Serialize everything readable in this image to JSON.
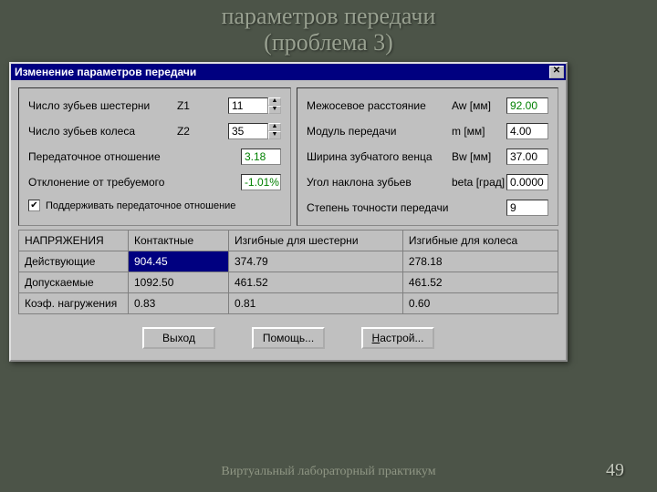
{
  "slide": {
    "title_line1": "параметров передачи",
    "title_line2": "(проблема 3)",
    "footer": "Виртуальный лабораторный практикум",
    "page": "49"
  },
  "dialog": {
    "title": "Изменение параметров передачи",
    "close": "✕"
  },
  "left": {
    "z1_label": "Число зубьев шестерни",
    "z1_sym": "Z1",
    "z1_val": "11",
    "z2_label": "Число зубьев колеса",
    "z2_sym": "Z2",
    "z2_val": "35",
    "ratio_label": "Передаточное отношение",
    "ratio_val": "3.18",
    "dev_label": "Отклонение от требуемого",
    "dev_val": "-1.01%",
    "chk_label": "Поддерживать передаточное отношение"
  },
  "right": {
    "aw_label": "Межосевое расстояние",
    "aw_sym": "Aw [мм]",
    "aw_val": "92.00",
    "m_label": "Модуль передачи",
    "m_sym": "m [мм]",
    "m_val": "4.00",
    "bw_label": "Ширина зубчатого венца",
    "bw_sym": "Bw [мм]",
    "bw_val": "37.00",
    "beta_label": "Угол наклона зубьев",
    "beta_sym": "beta [град]",
    "beta_val": "0.0000",
    "acc_label": "Степень точности передачи",
    "acc_val": "9"
  },
  "table": {
    "h0": "НАПРЯЖЕНИЯ",
    "h1": "Контактные",
    "h2": "Изгибные для шестерни",
    "h3": "Изгибные для колеса",
    "r1": "Действующие",
    "r1c1": "904.45",
    "r1c2": "374.79",
    "r1c3": "278.18",
    "r2": "Допускаемые",
    "r2c1": "1092.50",
    "r2c2": "461.52",
    "r2c3": "461.52",
    "r3": "Коэф. нагружения",
    "r3c1": "0.83",
    "r3c2": "0.81",
    "r3c3": "0.60"
  },
  "buttons": {
    "exit": "Выход",
    "help": "Помощь...",
    "setup_u": "Н",
    "setup_rest": "астрой..."
  }
}
